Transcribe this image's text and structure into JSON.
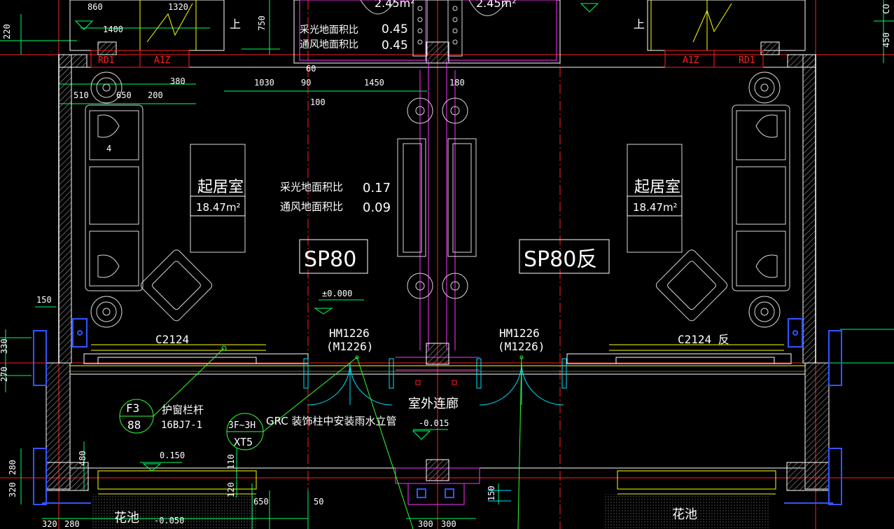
{
  "colors": {
    "background": "#000000",
    "wall": "#ffffff",
    "axis": "#ff2020",
    "dimension": "#00ff66",
    "window": "#ffff00",
    "door": "#00e5ff",
    "furniture": "#d8d8d8",
    "fixture": "#ff33ff",
    "column_hatch": "#b0b0b0",
    "leader": "#33ff33",
    "blue": "#3355ff",
    "yellow": "#ffff33"
  },
  "top_texts": {
    "dim_860": "860",
    "dim_1320": "1320",
    "dim_1400": "1400",
    "dim_220": "220",
    "dim_750": "750",
    "up_left": "上",
    "up_right": "上",
    "area_left": "2.45m²",
    "area_right": "2.45m²",
    "light_ratio_label": "采光地面积比",
    "light_ratio_value": "0.45",
    "vent_ratio_label": "通风地面积比",
    "vent_ratio_value": "0.45",
    "dim_450": "450",
    "col_label": "CO"
  },
  "tags": {
    "rd1_left": "RD1",
    "a1z_left": "A1Z",
    "a1z_right": "A1Z",
    "rd1_right": "RD1"
  },
  "dims": {
    "d60": "60",
    "d380": "380",
    "d1030": "1030",
    "d90": "90",
    "d1450": "1450",
    "d180": "180",
    "d100": "100",
    "d510": "510",
    "d650": "650",
    "d200": "200",
    "d150": "150",
    "d330": "330",
    "d270": "270",
    "d480": "480",
    "d280": "280",
    "d320": "320",
    "d110": "110",
    "d120": "120",
    "d650b": "650",
    "d50": "50",
    "d150b": "150",
    "d320b": "320",
    "d280b": "280",
    "d300a": "300",
    "d300b": "300",
    "d4": "4"
  },
  "rooms": {
    "living_left_name": "起居室",
    "living_left_area": "18.47m²",
    "living_right_name": "起居室",
    "living_right_area": "18.47m²",
    "light_ratio_label": "采光地面积比",
    "light_ratio_value": "0.17",
    "vent_ratio_label": "通风地面积比",
    "vent_ratio_value": "0.09",
    "corridor_name": "室外连廊",
    "flower_left": "花池",
    "flower_right": "花池"
  },
  "unit_tags": {
    "left": "SP80",
    "right": "SP80反"
  },
  "elevations": {
    "floor": "±0.000",
    "corridor": "-0.015",
    "left_step": "0.150",
    "bottom": "-0.050"
  },
  "doors": {
    "left_code": "HM1226",
    "left_alt": "(M1226)",
    "right_code": "HM1226",
    "right_alt": "(M1226)"
  },
  "windows": {
    "left": "C2124",
    "right": "C2124 反"
  },
  "references": {
    "f3_top": "F3",
    "f3_bottom": "88",
    "railing_label": "护窗栏杆",
    "railing_std": "16BJ7-1",
    "xt5_top": "3F~3H",
    "xt5_bottom": "XT5",
    "grc_note": "GRC 装饰柱中安装雨水立管"
  }
}
